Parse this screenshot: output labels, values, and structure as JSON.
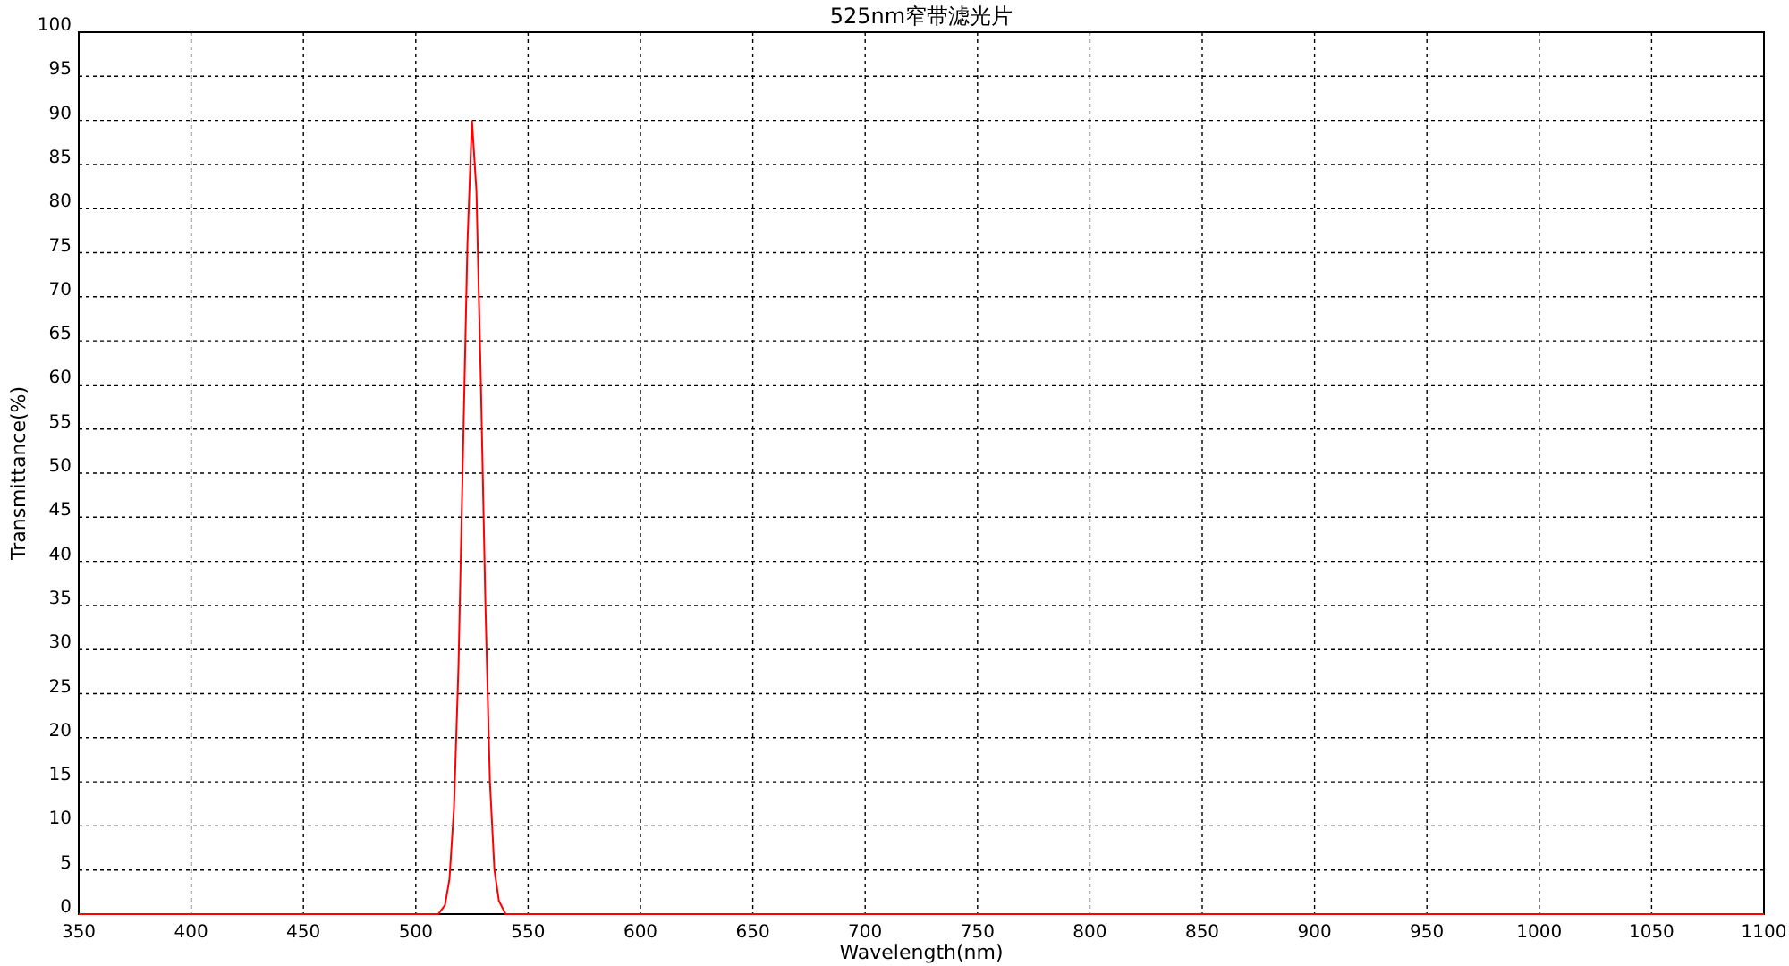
{
  "chart_data": {
    "type": "line",
    "title": "525nm窄带滤光片",
    "xlabel": "Wavelength(nm)",
    "ylabel": "Transmittance(%)",
    "grid": true,
    "xlim": [
      350,
      1100
    ],
    "ylim": [
      0,
      100
    ],
    "xticks": [
      350,
      400,
      450,
      500,
      550,
      600,
      650,
      700,
      750,
      800,
      850,
      900,
      950,
      1000,
      1050,
      1100
    ],
    "yticks": [
      0,
      5,
      10,
      15,
      20,
      25,
      30,
      35,
      40,
      45,
      50,
      55,
      60,
      65,
      70,
      75,
      80,
      85,
      90,
      95,
      100
    ],
    "x": [
      350,
      500,
      510,
      513,
      515,
      517,
      519,
      521,
      523,
      525,
      527,
      529,
      531,
      533,
      535,
      537,
      540,
      600,
      1100
    ],
    "series": [
      {
        "color": "#ff0000",
        "values": [
          0,
          0,
          0,
          1,
          4,
          12,
          28,
          52,
          76,
          90,
          82,
          60,
          35,
          15,
          5,
          1.5,
          0,
          0,
          0
        ]
      }
    ]
  }
}
